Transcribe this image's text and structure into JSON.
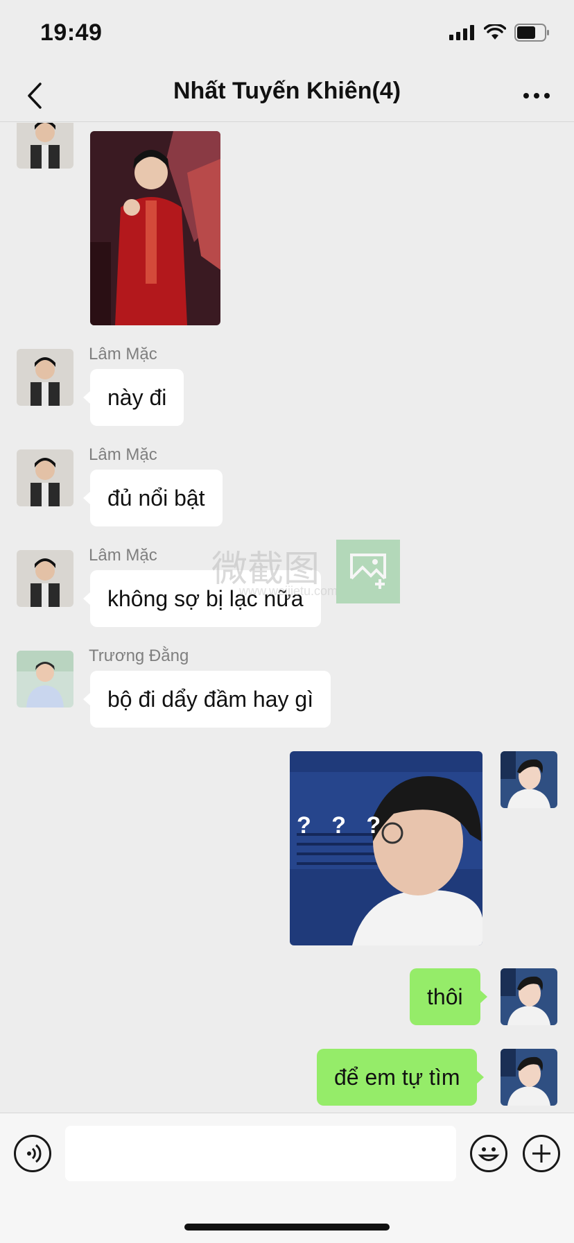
{
  "status_bar": {
    "time": "19:49"
  },
  "nav": {
    "title": "Nhất Tuyến Khiên(4)"
  },
  "messages": [
    {
      "type": "image",
      "side": "left",
      "description_icon": "photo-red-suit"
    },
    {
      "type": "text",
      "side": "left",
      "sender": "Lâm Mặc",
      "text": "này đi"
    },
    {
      "type": "text",
      "side": "left",
      "sender": "Lâm Mặc",
      "text": "đủ nổi bật"
    },
    {
      "type": "text",
      "side": "left",
      "sender": "Lâm Mặc",
      "text": "không sợ bị lạc nữa"
    },
    {
      "type": "text",
      "side": "left",
      "sender": "Trương Đằng",
      "text": "bộ đi dẩy đầm hay gì"
    },
    {
      "type": "image",
      "side": "right",
      "overlay_text": "? ? ?"
    },
    {
      "type": "text",
      "side": "right",
      "text": "thôi"
    },
    {
      "type": "text",
      "side": "right",
      "text": "để em tự tìm"
    }
  ],
  "watermark": {
    "text": "微截图",
    "url": "www.weijietu.com"
  },
  "input": {
    "value": "",
    "placeholder": ""
  },
  "colors": {
    "background": "#ededed",
    "incoming_bubble": "#ffffff",
    "outgoing_bubble": "#95ec69"
  }
}
